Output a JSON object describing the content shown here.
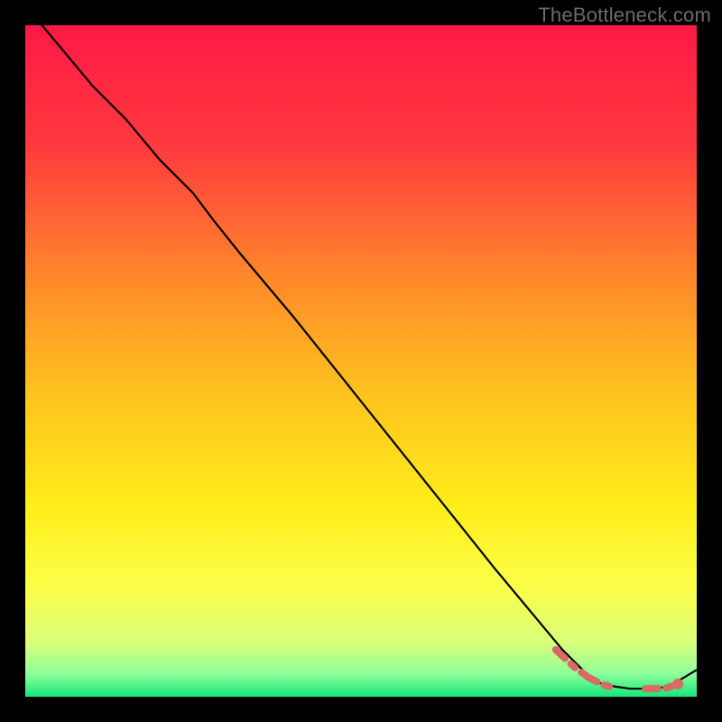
{
  "watermark": "TheBottleneck.com",
  "chart_data": {
    "type": "line",
    "title": "",
    "xlabel": "",
    "ylabel": "",
    "xlim": [
      0,
      100
    ],
    "ylim": [
      0,
      100
    ],
    "grid": false,
    "legend": false,
    "gradient_stops": [
      {
        "offset": 0.0,
        "color": "#ff1846"
      },
      {
        "offset": 0.18,
        "color": "#ff3a3e"
      },
      {
        "offset": 0.38,
        "color": "#ff8a2a"
      },
      {
        "offset": 0.55,
        "color": "#ffc31e"
      },
      {
        "offset": 0.72,
        "color": "#ffee1a"
      },
      {
        "offset": 0.84,
        "color": "#fbff4a"
      },
      {
        "offset": 0.92,
        "color": "#d9ff7a"
      },
      {
        "offset": 0.965,
        "color": "#8fff9a"
      },
      {
        "offset": 1.0,
        "color": "#16e77a"
      }
    ],
    "series": [
      {
        "name": "bottleneck-curve",
        "stroke": "#000000",
        "stroke_width": 2.2,
        "x": [
          0,
          5,
          10,
          15,
          20,
          25,
          28,
          32,
          40,
          50,
          60,
          70,
          80,
          84,
          86,
          90,
          94,
          96,
          100
        ],
        "values": [
          103,
          97,
          91,
          86,
          80,
          75,
          71,
          66,
          56.5,
          44,
          31.5,
          19,
          7,
          3,
          1.8,
          1.2,
          1.2,
          1.6,
          4
        ]
      }
    ],
    "annotations": [
      {
        "name": "flat-segment-marker",
        "stroke": "#d86b66",
        "stroke_width": 8,
        "linecap": "round",
        "dash": [
          14,
          9,
          6,
          9,
          20,
          9,
          6,
          40
        ],
        "x": [
          79,
          82,
          84,
          86,
          87.5,
          90,
          92,
          94,
          95.5,
          97.2
        ],
        "values": [
          7,
          4.2,
          2.8,
          1.8,
          1.4,
          1.2,
          1.2,
          1.2,
          1.3,
          1.9
        ]
      }
    ],
    "markers": [
      {
        "name": "end-dot",
        "x": 97.2,
        "y": 1.9,
        "r": 6,
        "fill": "#d86b66"
      }
    ]
  }
}
